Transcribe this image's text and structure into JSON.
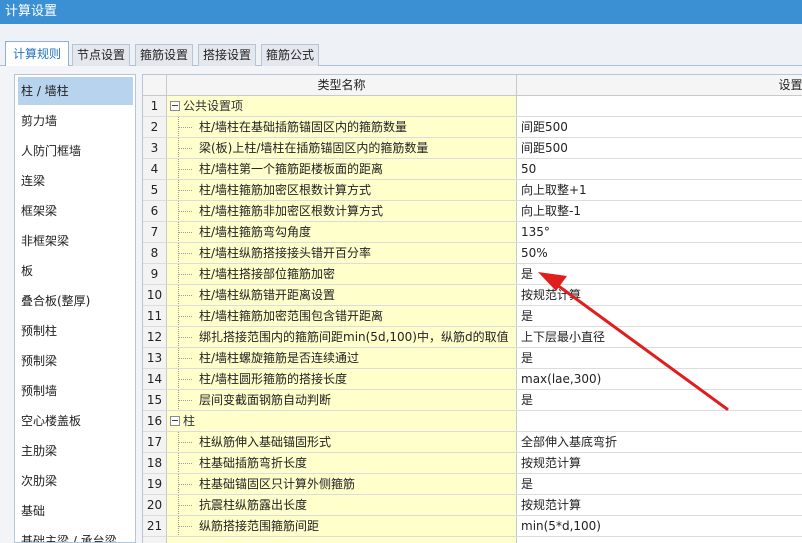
{
  "window": {
    "title": "计算设置"
  },
  "tabs": [
    {
      "label": "计算规则",
      "active": true
    },
    {
      "label": "节点设置",
      "active": false
    },
    {
      "label": "箍筋设置",
      "active": false
    },
    {
      "label": "搭接设置",
      "active": false
    },
    {
      "label": "箍筋公式",
      "active": false
    }
  ],
  "sidebar": {
    "items": [
      {
        "label": "柱 / 墙柱",
        "selected": true
      },
      {
        "label": "剪力墙"
      },
      {
        "label": "人防门框墙"
      },
      {
        "label": "连梁"
      },
      {
        "label": "框架梁"
      },
      {
        "label": "非框架梁"
      },
      {
        "label": "板"
      },
      {
        "label": "叠合板(整厚)"
      },
      {
        "label": "预制柱"
      },
      {
        "label": "预制梁"
      },
      {
        "label": "预制墙"
      },
      {
        "label": "空心楼盖板"
      },
      {
        "label": "主肋梁"
      },
      {
        "label": "次肋梁"
      },
      {
        "label": "基础"
      },
      {
        "label": "基础主梁 / 承台梁"
      }
    ]
  },
  "grid": {
    "headers": {
      "name": "类型名称",
      "value": "设置值"
    },
    "rows": [
      {
        "num": "1",
        "name": "公共设置项",
        "value": "",
        "group": true
      },
      {
        "num": "2",
        "name": "柱/墙柱在基础插筋锚固区内的箍筋数量",
        "value": "间距500"
      },
      {
        "num": "3",
        "name": "梁(板)上柱/墙柱在插筋锚固区内的箍筋数量",
        "value": "间距500"
      },
      {
        "num": "4",
        "name": "柱/墙柱第一个箍筋距楼板面的距离",
        "value": "50"
      },
      {
        "num": "5",
        "name": "柱/墙柱箍筋加密区根数计算方式",
        "value": "向上取整+1"
      },
      {
        "num": "6",
        "name": "柱/墙柱箍筋非加密区根数计算方式",
        "value": "向上取整-1"
      },
      {
        "num": "7",
        "name": "柱/墙柱箍筋弯勾角度",
        "value": "135°"
      },
      {
        "num": "8",
        "name": "柱/墙柱纵筋搭接接头错开百分率",
        "value": "50%"
      },
      {
        "num": "9",
        "name": "柱/墙柱搭接部位箍筋加密",
        "value": "是"
      },
      {
        "num": "10",
        "name": "柱/墙柱纵筋错开距离设置",
        "value": "按规范计算"
      },
      {
        "num": "11",
        "name": "柱/墙柱箍筋加密范围包含错开距离",
        "value": "是"
      },
      {
        "num": "12",
        "name": "绑扎搭接范围内的箍筋间距min(5d,100)中，纵筋d的取值",
        "value": "上下层最小直径"
      },
      {
        "num": "13",
        "name": "柱/墙柱螺旋箍筋是否连续通过",
        "value": "是"
      },
      {
        "num": "14",
        "name": "柱/墙柱圆形箍筋的搭接长度",
        "value": "max(lae,300)"
      },
      {
        "num": "15",
        "name": "层间变截面钢筋自动判断",
        "value": "是"
      },
      {
        "num": "16",
        "name": "柱",
        "value": "",
        "group": true
      },
      {
        "num": "17",
        "name": "柱纵筋伸入基础锚固形式",
        "value": "全部伸入基底弯折"
      },
      {
        "num": "18",
        "name": "柱基础插筋弯折长度",
        "value": "按规范计算"
      },
      {
        "num": "19",
        "name": "柱基础锚固区只计算外侧箍筋",
        "value": "是"
      },
      {
        "num": "20",
        "name": "抗震柱纵筋露出长度",
        "value": "按规范计算"
      },
      {
        "num": "21",
        "name": "纵筋搭接范围箍筋间距",
        "value": "min(5*d,100)"
      }
    ]
  },
  "annotation": {
    "color": "#e01e1e"
  }
}
